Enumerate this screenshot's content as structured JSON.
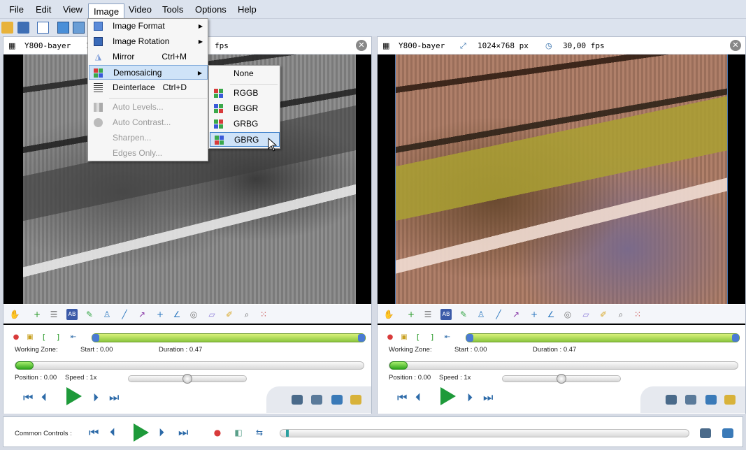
{
  "menubar": {
    "items": [
      "File",
      "Edit",
      "View",
      "Image",
      "Video",
      "Tools",
      "Options",
      "Help"
    ],
    "active": "Image"
  },
  "image_menu": {
    "items": [
      {
        "label": "Image Format",
        "shortcut": "",
        "submenu": true,
        "disabled": false,
        "icon": "image-format-icon"
      },
      {
        "label": "Image Rotation",
        "shortcut": "",
        "submenu": true,
        "disabled": false,
        "icon": "image-rotation-icon"
      },
      {
        "label": "Mirror",
        "shortcut": "Ctrl+M",
        "submenu": false,
        "disabled": false,
        "icon": "mirror-icon"
      },
      {
        "label": "Demosaicing",
        "shortcut": "",
        "submenu": true,
        "disabled": false,
        "highlighted": true,
        "icon": "demosaicing-icon"
      },
      {
        "label": "Deinterlace",
        "shortcut": "Ctrl+D",
        "submenu": false,
        "disabled": false,
        "icon": "deinterlace-icon"
      },
      {
        "label": "Auto Levels...",
        "shortcut": "",
        "submenu": false,
        "disabled": true,
        "icon": "auto-levels-icon"
      },
      {
        "label": "Auto Contrast...",
        "shortcut": "",
        "submenu": false,
        "disabled": true,
        "icon": "auto-contrast-icon"
      },
      {
        "label": "Sharpen...",
        "shortcut": "",
        "submenu": false,
        "disabled": true,
        "icon": ""
      },
      {
        "label": "Edges Only...",
        "shortcut": "",
        "submenu": false,
        "disabled": true,
        "icon": ""
      }
    ]
  },
  "demosaicing_submenu": {
    "items": [
      "None",
      "RGGB",
      "BGGR",
      "GRBG",
      "GBRG"
    ],
    "selected": "GBRG"
  },
  "left_pane": {
    "name": "Y800-bayer",
    "resolution_partial": "1",
    "fps_partial": "fps"
  },
  "right_pane": {
    "name": "Y800-bayer",
    "resolution": "1024×768 px",
    "fps": "30,00 fps"
  },
  "controls": {
    "working_zone_label": "Working Zone:",
    "start_label": "Start : 0.00",
    "duration_label": "Duration : 0.47",
    "position_label": "Position : 0.00",
    "speed_label": "Speed : 1x",
    "position_fraction": 0,
    "speed_fraction": 0.5
  },
  "common": {
    "label": "Common Controls :"
  },
  "colors": {
    "menubar_bg": "#dce3ee",
    "highlight_bg": "#cfe3f8",
    "play_green": "#1e9a3a",
    "nav_blue": "#2c6aa8",
    "zone_green": "#8cc63f"
  }
}
